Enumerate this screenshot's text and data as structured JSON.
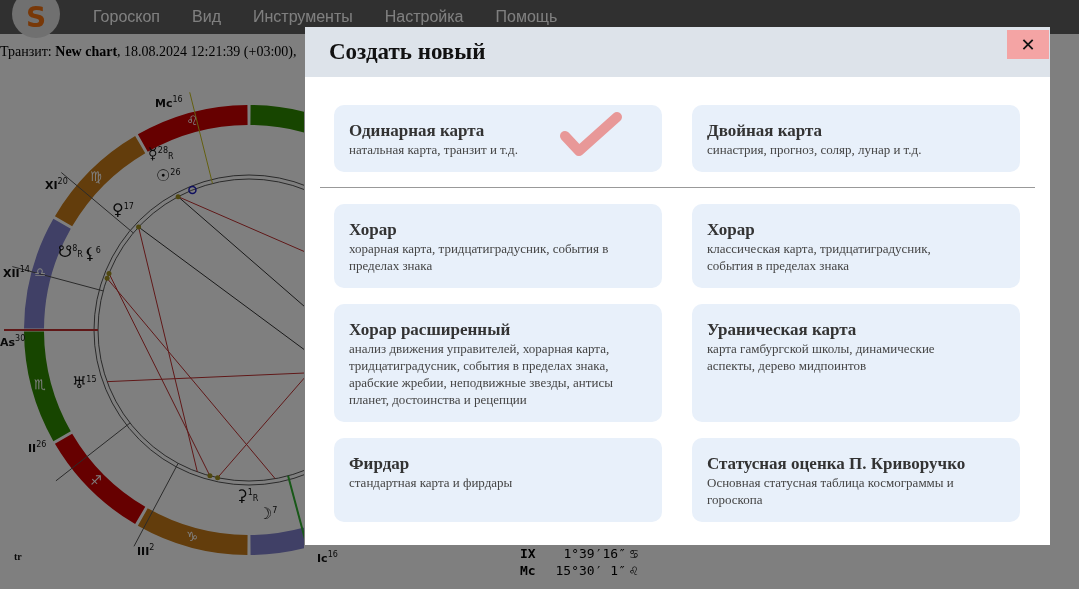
{
  "logo": {
    "letter": "S"
  },
  "menu": [
    "Гороскоп",
    "Вид",
    "Инструменты",
    "Настройка",
    "Помощь"
  ],
  "subheader": "Транзит: **New chart**, 18.08.2024 12:21:39 (+03:00),",
  "chart": {
    "signs": [
      "♌",
      "♍",
      "♎",
      "♏",
      "♐",
      "♑"
    ],
    "cusps": [
      {
        "label": "Mc",
        "degree": "16"
      },
      {
        "label": "XI",
        "degree": "20"
      },
      {
        "label": "XII",
        "degree": "14"
      },
      {
        "label": "As",
        "degree": "30"
      },
      {
        "label": "II",
        "degree": "26"
      },
      {
        "label": "III",
        "degree": "2"
      },
      {
        "label": "Ic",
        "degree": "16"
      }
    ],
    "planets": [
      {
        "glyph": "☿",
        "degree": "28",
        "retro": "R"
      },
      {
        "glyph": "☉",
        "degree": "26"
      },
      {
        "glyph": "♀",
        "degree": "17"
      },
      {
        "glyph": "☋",
        "degree": "8",
        "retro": "R"
      },
      {
        "glyph": "⚸",
        "degree": "6"
      },
      {
        "glyph": "♅",
        "degree": "15"
      },
      {
        "glyph": "⚳",
        "degree": "1",
        "retro": "R"
      },
      {
        "glyph": "☽",
        "degree": "7"
      }
    ],
    "corner_label": "tr"
  },
  "positions": [
    {
      "point": "IX",
      "value": "1°39′16″",
      "sign": "♋"
    },
    {
      "point": "Mc",
      "value": "15°30′ 1″",
      "sign": "♌"
    }
  ],
  "dialog": {
    "title": "Создать новый",
    "close": "✕",
    "sections": [
      {
        "cards": [
          {
            "title": "Одинарная карта",
            "description": "натальная карта, транзит и т.д.",
            "selected": true
          },
          {
            "title": "Двойная карта",
            "description": "синастрия, прогноз, соляр, лунар и т.д.",
            "selected": false
          }
        ]
      },
      {
        "cards": [
          {
            "title": "Хорар",
            "description": "хорарная карта, тридцатиградусник, события в пределах знака",
            "selected": false
          },
          {
            "title": "Хорар",
            "description": "классическая карта, тридцатиградусник, события в пределах знака",
            "selected": false
          },
          {
            "title": "Хорар расширенный",
            "description": "анализ движения управителей, хорарная карта, тридцатиградусник, события в пределах знака, арабские жребии, неподвижные звезды, антисы планет, достоинства и рецепции",
            "selected": false
          },
          {
            "title": "Ураническая карта",
            "description": "карта гамбургской школы, динамические аспекты, дерево мидпоинтов",
            "selected": false
          },
          {
            "title": "Фирдар",
            "description": "стандартная карта и фирдары",
            "selected": false
          },
          {
            "title": "Статусная оценка П. Криворучко",
            "description": "Основная статусная таблица космограммы и гороскопа",
            "selected": false
          }
        ]
      }
    ]
  }
}
